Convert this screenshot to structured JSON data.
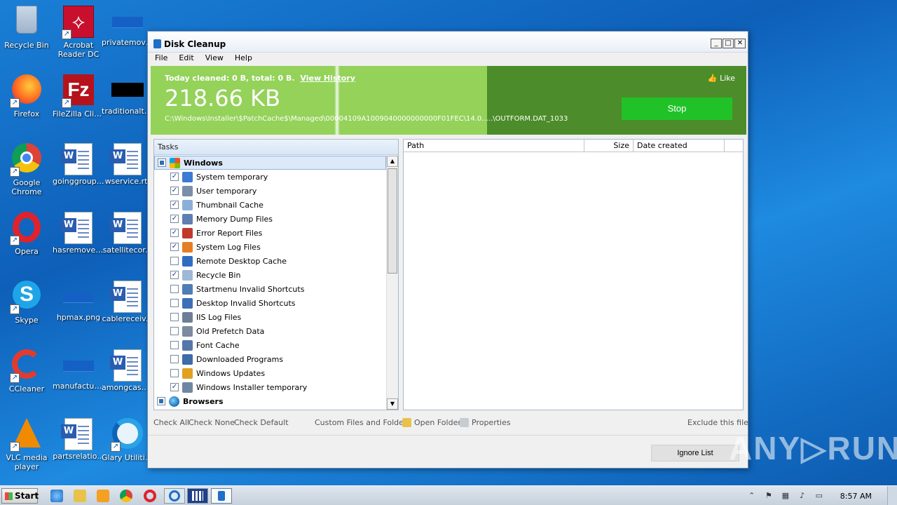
{
  "desktop": {
    "icons": [
      {
        "label": "Recycle Bin"
      },
      {
        "label": "Acrobat Reader DC"
      },
      {
        "label": "privatemovi..."
      },
      {
        "label": "Firefox"
      },
      {
        "label": "FileZilla Client"
      },
      {
        "label": "traditionalth..."
      },
      {
        "label": "Google Chrome"
      },
      {
        "label": "goinggroup.rtf"
      },
      {
        "label": "wservice.rtf"
      },
      {
        "label": "Opera"
      },
      {
        "label": "hasremove.rtf"
      },
      {
        "label": "satellitecor..."
      },
      {
        "label": "Skype"
      },
      {
        "label": "hpmax.png"
      },
      {
        "label": "cablereceiv..."
      },
      {
        "label": "CCleaner"
      },
      {
        "label": "manufacturi..."
      },
      {
        "label": "amongcash..."
      },
      {
        "label": "VLC media player"
      },
      {
        "label": "partsrelatio..."
      },
      {
        "label": "Glary Utilities"
      }
    ]
  },
  "window": {
    "title": "Disk Cleanup",
    "controls": {
      "minimize": "_",
      "maximize": "□",
      "close": "✕"
    },
    "menu": [
      "File",
      "Edit",
      "View",
      "Help"
    ]
  },
  "banner": {
    "summary": "Today cleaned: 0 B, total: 0 B.",
    "view_history": "View History",
    "cleaned_size": "218.66 KB",
    "current_path": "C:\\Windows\\Installer\\$PatchCache$\\Managed\\00004109A1009040000000000F01FEC\\14.0.....\\OUTFORM.DAT_1033",
    "like": "Like",
    "stop": "Stop",
    "progress_fraction": 0.565,
    "colors": {
      "done": "#94d25a",
      "remaining": "#4c8c2a",
      "stop": "#21c228"
    }
  },
  "tasks": {
    "header": "Tasks",
    "groups": [
      {
        "label": "Windows",
        "state": "partial"
      },
      {
        "label": "Browsers",
        "state": "partial"
      }
    ],
    "items": [
      {
        "label": "System temporary",
        "checked": true,
        "icon_color": "#3b7bd3"
      },
      {
        "label": "User temporary",
        "checked": true,
        "icon_color": "#7a8ea8"
      },
      {
        "label": "Thumbnail Cache",
        "checked": true,
        "icon_color": "#8bb0d8"
      },
      {
        "label": "Memory Dump Files",
        "checked": true,
        "icon_color": "#5f7fb0"
      },
      {
        "label": "Error Report Files",
        "checked": true,
        "icon_color": "#c0392b"
      },
      {
        "label": "System Log Files",
        "checked": true,
        "icon_color": "#e57e22"
      },
      {
        "label": "Remote Desktop Cache",
        "checked": false,
        "icon_color": "#2f6dc2"
      },
      {
        "label": "Recycle Bin",
        "checked": true,
        "icon_color": "#9fb8d6"
      },
      {
        "label": "Startmenu Invalid Shortcuts",
        "checked": false,
        "icon_color": "#4f7db5"
      },
      {
        "label": "Desktop Invalid Shortcuts",
        "checked": false,
        "icon_color": "#3c6fb7"
      },
      {
        "label": "IIS Log Files",
        "checked": false,
        "icon_color": "#6d7f96"
      },
      {
        "label": "Old Prefetch Data",
        "checked": false,
        "icon_color": "#7c8b9d"
      },
      {
        "label": "Font Cache",
        "checked": false,
        "icon_color": "#5577aa"
      },
      {
        "label": "Downloaded Programs",
        "checked": false,
        "icon_color": "#3d6ca8"
      },
      {
        "label": "Windows Updates",
        "checked": false,
        "icon_color": "#e0a020"
      },
      {
        "label": "Windows Installer temporary",
        "checked": true,
        "icon_color": "#6f86a3"
      }
    ]
  },
  "details": {
    "columns": [
      "Path",
      "Size",
      "Date created"
    ]
  },
  "actions": {
    "check_all": "Check All",
    "check_none": "Check None",
    "check_default": "Check Default",
    "custom_files": "Custom Files and Folders",
    "open_folder": "Open Folder",
    "properties": "Properties",
    "exclude": "Exclude this file",
    "ignore_list": "Ignore List"
  },
  "watermark": "ANY▷RUN",
  "taskbar": {
    "start": "Start",
    "clock": "8:57 AM"
  }
}
